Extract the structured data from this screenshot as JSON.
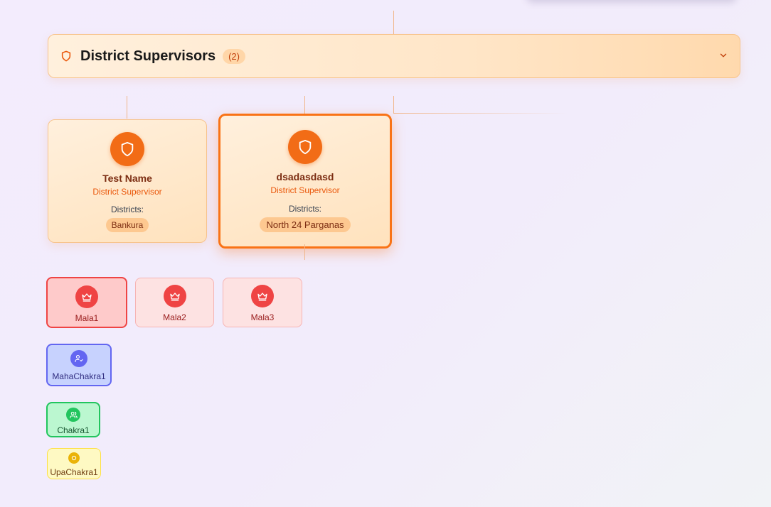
{
  "section": {
    "title": "District Supervisors",
    "count": "(2)"
  },
  "supervisors": [
    {
      "name": "Test Name",
      "role": "District Supervisor",
      "districts_label": "Districts:",
      "districts": [
        "Bankura"
      ]
    },
    {
      "name": "dsadasdasd",
      "role": "District Supervisor",
      "districts_label": "Districts:",
      "districts": [
        "North 24 Parganas"
      ]
    }
  ],
  "malas": [
    {
      "label": "Mala1",
      "selected": true
    },
    {
      "label": "Mala2",
      "selected": false
    },
    {
      "label": "Mala3",
      "selected": false
    }
  ],
  "mahachakra": {
    "label": "MahaChakra1"
  },
  "chakra": {
    "label": "Chakra1"
  },
  "upachakra": {
    "label": "UpaChakra1"
  },
  "colors": {
    "supervisor_accent": "#f26c16",
    "mala": "#ef4444",
    "mahachakra": "#6366f1",
    "chakra": "#22c55e",
    "upachakra": "#eab308"
  },
  "icons": {
    "section": "shield-icon",
    "collapse": "chevron-down-icon",
    "supervisor": "shield-icon",
    "mala": "crown-icon",
    "mahachakra": "user-check-icon",
    "chakra": "users-icon",
    "upachakra": "circle-dot-icon"
  }
}
